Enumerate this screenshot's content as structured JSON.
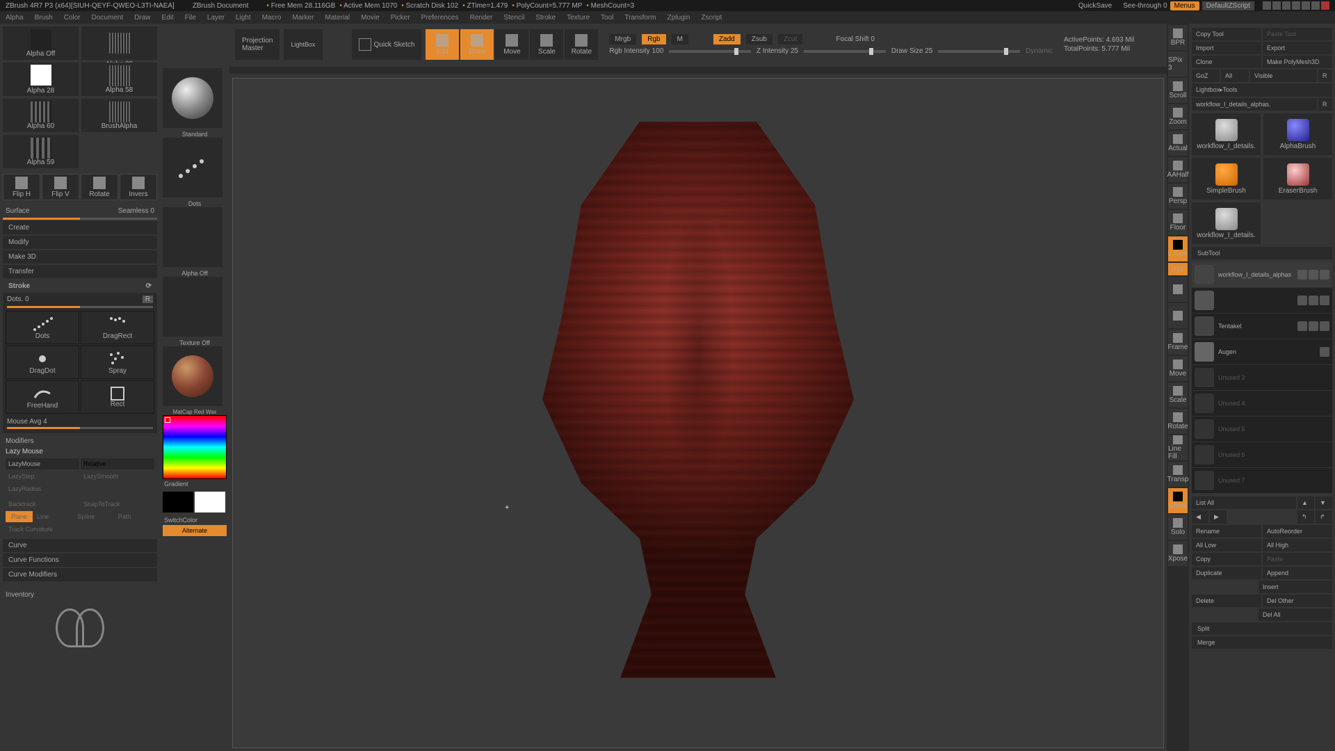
{
  "titlebar": {
    "app": "ZBrush 4R7 P3 (x64)[SIUH-QEYF-QWEO-L3TI-NAEA]",
    "doc": "ZBrush Document",
    "freemem": "Free Mem 28.116GB",
    "activemem": "Active Mem 1070",
    "scratch": "Scratch Disk 102",
    "ztime": "ZTime=1.479",
    "polycount": "PolyCount=5.777 MP",
    "meshcount": "MeshCount=3",
    "quicksave": "QuickSave",
    "seethrough": "See-through  0",
    "menus": "Menus",
    "default": "DefaultZScript"
  },
  "menu": [
    "Alpha",
    "Brush",
    "Color",
    "Document",
    "Draw",
    "Edit",
    "File",
    "Layer",
    "Light",
    "Macro",
    "Marker",
    "Material",
    "Movie",
    "Picker",
    "Preferences",
    "Render",
    "Stencil",
    "Stroke",
    "Texture",
    "Tool",
    "Transform",
    "Zplugin",
    "Zscript"
  ],
  "alpha_items": [
    "Alpha Off",
    "Alpha 28",
    "Alpha 58",
    "Alpha 60",
    "BrushAlpha",
    "Alpha 59"
  ],
  "flip_btns": [
    "Flip H",
    "Flip V",
    "Rotate",
    "Invers"
  ],
  "surface_label": "Surface",
  "seamless": "Seamless 0",
  "create_menu": [
    "Create",
    "Modify",
    "Make 3D",
    "Transfer"
  ],
  "stroke": {
    "header": "Stroke",
    "dots": "Dots. 0",
    "r": "R",
    "types": [
      "Dots",
      "DragRect",
      "DragDot",
      "Spray",
      "FreeHand",
      "Rect"
    ],
    "mouseavg": "Mouse Avg 4"
  },
  "modifiers": {
    "header": "Modifiers",
    "lazy": "Lazy Mouse",
    "lazymouse": "LazyMouse",
    "relative": "Relative",
    "lazystep": "LazyStep",
    "lazysmooth": "LazySmooth",
    "lazyradius": "LazyRadius",
    "backtrack": "Backtrack",
    "snap": "SnapToTrack",
    "modes": [
      "Plane",
      "Line",
      "Spline",
      "Path"
    ],
    "track": "Track Curvature"
  },
  "curve_items": [
    "Curve",
    "Curve Functions",
    "Curve Modifiers"
  ],
  "inventory": "Inventory",
  "toolcol": {
    "standard": "Standard",
    "dots": "Dots",
    "alphaoff": "Alpha Off",
    "texoff": "Texture Off",
    "matcap": "MatCap Red Wax",
    "gradient": "Gradient",
    "switch": "SwitchColor",
    "alternate": "Alternate"
  },
  "canvas_top": {
    "proj1": "Projection",
    "proj2": "Master",
    "lightbox": "LightBox",
    "quick": "Quick Sketch",
    "modes": [
      "Edit",
      "Draw",
      "Move",
      "Scale",
      "Rotate"
    ],
    "mrgb": "Mrgb",
    "rgb": "Rgb",
    "m": "M",
    "rgbint": "Rgb Intensity 100",
    "zadd": "Zadd",
    "zsub": "Zsub",
    "zcut": "Zcut",
    "zint": "Z Intensity 25",
    "focal": "Focal Shift 0",
    "draw": "Draw Size 25",
    "dynamic": "Dynamic",
    "active": "ActivePoints: 4.693 Mil",
    "total": "TotalPoints: 5.777 Mil"
  },
  "rside": [
    "BPR",
    "SPix 3",
    "Scroll",
    "Zoom",
    "Actual",
    "AAHalf",
    "Persp",
    "Floor",
    "L.Sym",
    "Xyz",
    "",
    "",
    "Frame",
    "Move",
    "Scale",
    "Rotate",
    "Line Fill",
    "Transp",
    "Ghost",
    "Solo",
    "Xpose"
  ],
  "rp": {
    "copytool": "Copy Tool",
    "pastetool": "Paste Tool",
    "import": "Import",
    "export": "Export",
    "clone": "Clone",
    "makepoly": "Make PolyMesh3D",
    "goz": "GoZ",
    "all": "All",
    "visible": "Visible",
    "r": "R",
    "lbtools": "Lightbox▸Tools",
    "workflow": "workflow_I_details_alphas.",
    "tools": [
      "workflow_I_details.",
      "AlphaBrush",
      "SimpleBrush",
      "EraserBrush",
      "workflow_I_details."
    ],
    "subtool": "SubTool",
    "st_items": [
      "workflow_I_details_alphas",
      "",
      "Tentakel",
      "Augen",
      "Unused 3",
      "Unused 4",
      "Unused 5",
      "Unused 6",
      "Unused 7"
    ],
    "listall": "List All",
    "rename": "Rename",
    "autoreorder": "AutoReorder",
    "alllow": "All Low",
    "allhigh": "All High",
    "copy": "Copy",
    "paste": "Paste",
    "duplicate": "Duplicate",
    "append": "Append",
    "insert": "Insert",
    "delete": "Delete",
    "delother": "Del Other",
    "delall": "Del All",
    "split": "Split",
    "merge": "Merge"
  }
}
